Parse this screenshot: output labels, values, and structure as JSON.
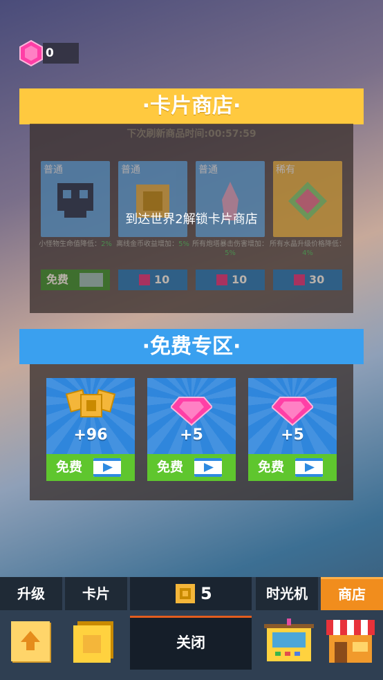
{
  "gems": {
    "count": "0"
  },
  "card_shop": {
    "title": "·卡片商店·",
    "refresh_label": "下次刷新商品时间:",
    "refresh_time": "00:57:59",
    "lock_message": "到达世界2解锁卡片商店",
    "cards": [
      {
        "rarity": "普通",
        "desc": "小怪物生命值降低：",
        "pct": "2%",
        "price": "免费",
        "color": "#5aa8e8"
      },
      {
        "rarity": "普通",
        "desc": "离线金币收益增加：",
        "pct": "5%",
        "price": "10",
        "color": "#5aa8e8"
      },
      {
        "rarity": "普通",
        "desc": "所有炮塔暴击伤害增加：",
        "pct": "5%",
        "price": "10",
        "color": "#5aa8e8"
      },
      {
        "rarity": "稀有",
        "desc": "所有水晶升级价格降低：",
        "pct": "4%",
        "price": "30",
        "color": "#f4b63a"
      }
    ]
  },
  "free_zone": {
    "title": "·免费专区·",
    "items": [
      {
        "amount": "+96",
        "claim": "免费",
        "reward": "coins"
      },
      {
        "amount": "+5",
        "claim": "免费",
        "reward": "gems"
      },
      {
        "amount": "+5",
        "claim": "免费",
        "reward": "gems"
      }
    ]
  },
  "bottom_nav": {
    "tabs": {
      "upgrade": "升级",
      "cards": "卡片",
      "time_machine": "时光机",
      "shop": "商店"
    },
    "coins": "5",
    "close": "关闭"
  },
  "colors": {
    "shop_banner": "#ffc93f",
    "free_banner": "#3aa0ef",
    "active_tab": "#f18d1d",
    "claim_green": "#5fc62e"
  }
}
